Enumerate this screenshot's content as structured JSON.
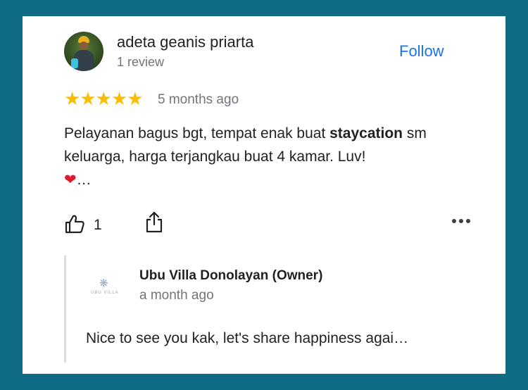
{
  "review": {
    "reviewer_name": "adeta geanis priarta",
    "review_count": "1 review",
    "follow_label": "Follow",
    "rating_stars": "★★★★★",
    "rating": 5,
    "time": "5 months ago",
    "text_part1": "Pelayanan bagus bgt, tempat enak buat ",
    "text_bold": "staycation",
    "text_part2": " sm keluarga, harga terjangkau buat 4 kamar. Luv! ",
    "text_emoji": "❤",
    "text_ellipsis": "…",
    "like_count": "1"
  },
  "owner_reply": {
    "name": "Ubu Villa Donolayan (Owner)",
    "time": "a month ago",
    "text": "Nice to see you kak, let's share happiness agai…",
    "logo_glyph": "❋",
    "logo_text": "UBU VILLA"
  },
  "icons": {
    "like": "thumbs-up-icon",
    "share": "share-icon",
    "more": "more-options-icon"
  },
  "colors": {
    "frame": "#0f6b83",
    "star": "#fbbc04",
    "link": "#1a73e8",
    "secondary_text": "#70757a"
  }
}
